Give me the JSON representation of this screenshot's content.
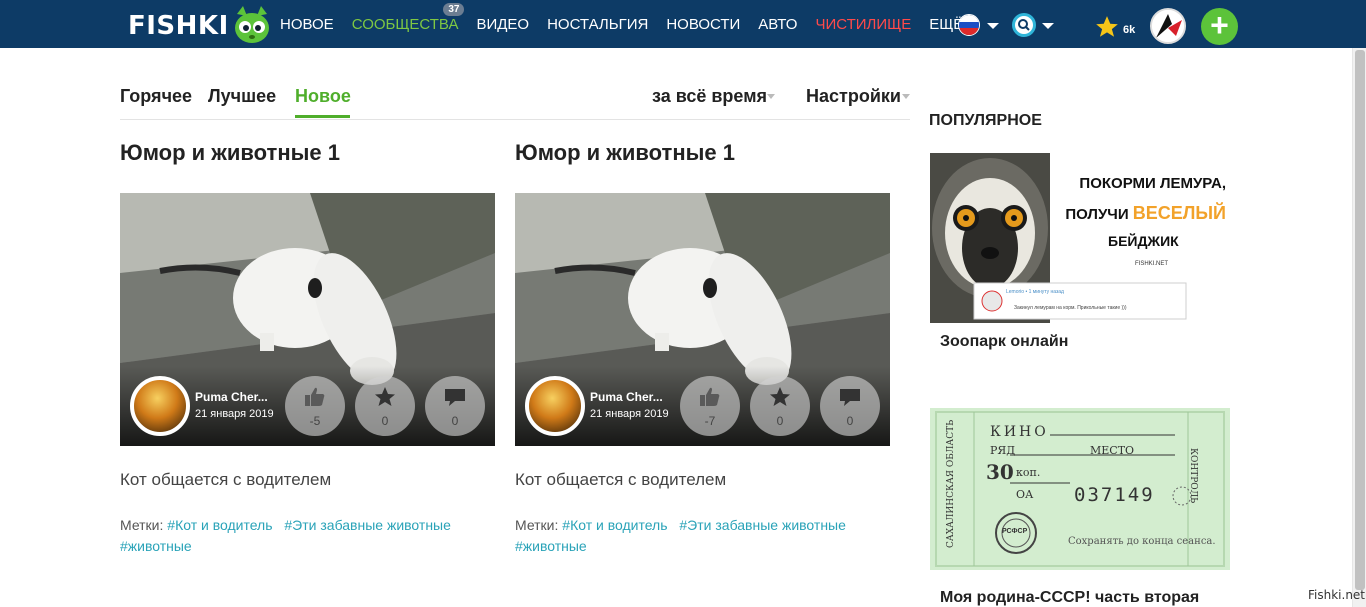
{
  "header": {
    "logo_text": "FISHKI",
    "nav": [
      {
        "label": "НОВОЕ"
      },
      {
        "label": "СООБЩЕСТВА",
        "badge": "37"
      },
      {
        "label": "ВИДЕО"
      },
      {
        "label": "НОСТАЛЬГИЯ"
      },
      {
        "label": "НОВОСТИ"
      },
      {
        "label": "АВТО"
      },
      {
        "label": "ЧИСТИЛИЩЕ"
      },
      {
        "label": "ЕЩЁ"
      }
    ],
    "star_count": "6k",
    "add_label": "+"
  },
  "tabs": {
    "hot": "Горячее",
    "best": "Лучшее",
    "new": "Новое",
    "period": "за всё время",
    "settings": "Настройки"
  },
  "posts": [
    {
      "title": "Юмор и животные 1",
      "author": "Puma Cher...",
      "date": "21 января 2019",
      "likes": "-5",
      "favorites": "0",
      "comments": "0",
      "description": "Кот общается с водителем",
      "tags_label": "Метки:",
      "tags": [
        "#Кот и водитель",
        "#Эти забавные животные",
        "#животные"
      ]
    },
    {
      "title": "Юмор и животные 1",
      "author": "Puma Cher...",
      "date": "21 января 2019",
      "likes": "-7",
      "favorites": "0",
      "comments": "0",
      "description": "Кот общается с водителем",
      "tags_label": "Метки:",
      "tags": [
        "#Кот и водитель",
        "#Эти забавные животные",
        "#животные"
      ]
    }
  ],
  "sidebar": {
    "title": "ПОПУЛЯРНОЕ",
    "items": [
      {
        "caption": "Зоопарк онлайн",
        "banner_line1": "ПОКОРМИ ЛЕМУРА,",
        "banner_line2a": "ПОЛУЧИ",
        "banner_line2b": "ВЕСЕЛЫЙ",
        "banner_line3": "БЕЙДЖИК",
        "banner_brand": "FISHKI.NET",
        "banner_card_line1": "Lemorio • 1 минуту назад",
        "banner_card_line2": "Закинул лемурам на корм. Прикольные такие )))"
      },
      {
        "caption": "Моя родина-СССР! часть вторая",
        "ticket_cinema": "КИНО",
        "ticket_row": "РЯД",
        "ticket_seat": "МЕСТО",
        "ticket_price": "30",
        "ticket_price_unit": "коп.",
        "ticket_series": "ОА",
        "ticket_number": "037149",
        "ticket_region": "САХАЛИНСКАЯ ОБЛАСТЬ",
        "ticket_control": "КОНТРОЛЬ",
        "ticket_keep": "Сохранять до конца сеанса.",
        "ticket_stamp": "РСФСР"
      }
    ]
  },
  "watermark": "Fishki.net",
  "colors": {
    "topbar": "#0d3b66",
    "accent_green": "#4fae2b",
    "community_green": "#7ec843",
    "purgatory_red": "#ff4a4a",
    "tag_teal": "#2aa3b8"
  }
}
